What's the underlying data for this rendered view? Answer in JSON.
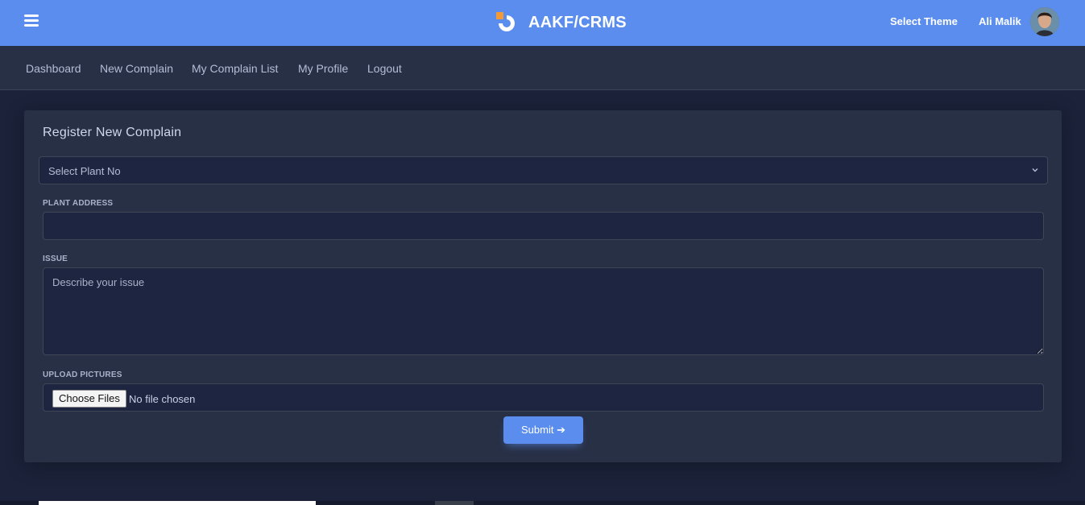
{
  "header": {
    "brand": "AAKF/CRMS",
    "theme_link": "Select Theme",
    "user_name": "Ali Malik"
  },
  "nav": {
    "items": [
      {
        "label": "Dashboard"
      },
      {
        "label": "New Complain"
      },
      {
        "label": "My Complain List"
      },
      {
        "label": "My Profile"
      },
      {
        "label": "Logout"
      }
    ]
  },
  "form": {
    "title": "Register New Complain",
    "plant_select": {
      "value": "Select Plant No"
    },
    "plant_address": {
      "label": "PLANT ADDRESS",
      "value": ""
    },
    "issue": {
      "label": "ISSUE",
      "placeholder": "Describe your issue"
    },
    "upload": {
      "label": "UPLOAD PICTURES",
      "button_label": "Choose Files",
      "status": "No file chosen"
    },
    "submit_label": "Submit ➔"
  },
  "colors": {
    "accent": "#5a8dee",
    "background": "#1b2239",
    "card": "#283046",
    "logo_orange": "#f29a37"
  },
  "icons": {
    "menu": "hamburger-icon",
    "chevron": "chevron-down-icon",
    "logo": "brand-logo-icon"
  }
}
